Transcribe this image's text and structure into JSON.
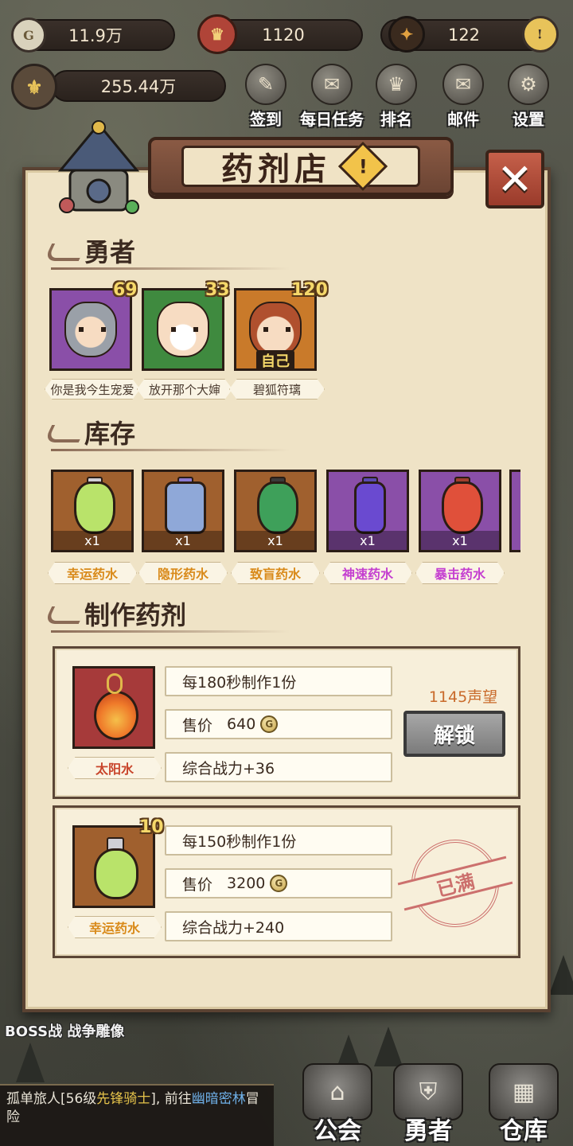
{
  "resources": {
    "gold": "11.9万",
    "honor": "1120",
    "gems": "122",
    "power": "255.44万"
  },
  "top_menu": [
    {
      "label": "签到",
      "icon": "sign-in-icon"
    },
    {
      "label": "每日任务",
      "icon": "daily-quest-icon"
    },
    {
      "label": "排名",
      "icon": "ranking-icon"
    },
    {
      "label": "邮件",
      "icon": "mail-icon"
    },
    {
      "label": "设置",
      "icon": "settings-gear-icon"
    }
  ],
  "panel": {
    "title": "药剂店",
    "sections": {
      "heroes": "勇者",
      "inventory": "库存",
      "crafting": "制作药剂"
    }
  },
  "heroes": [
    {
      "name": "你是我今生宠爱",
      "level": "69",
      "frame_color": "#8a4fa8",
      "self": false
    },
    {
      "name": "放开那个大婶",
      "level": "33",
      "frame_color": "#3f8a3f",
      "self": false
    },
    {
      "name": "碧狐符璃",
      "level": "120",
      "frame_color": "#c97a2a",
      "self": true,
      "self_label": "自己"
    }
  ],
  "inventory": [
    {
      "name": "幸运药水",
      "qty": "x1",
      "name_color": "#d98a1a",
      "frame_color": "#a0602e",
      "liquid": "#b9e36a"
    },
    {
      "name": "隐形药水",
      "qty": "x1",
      "name_color": "#d98a1a",
      "frame_color": "#a0602e",
      "liquid": "#8fa8d8"
    },
    {
      "name": "致盲药水",
      "qty": "x1",
      "name_color": "#d98a1a",
      "frame_color": "#a0602e",
      "liquid": "#3ea05a"
    },
    {
      "name": "神速药水",
      "qty": "x1",
      "name_color": "#c43ed0",
      "frame_color": "#8a4fa8",
      "liquid": "#6a4ad0"
    },
    {
      "name": "暴击药水",
      "qty": "x1",
      "name_color": "#c43ed0",
      "frame_color": "#8a4fa8",
      "liquid": "#e0503a"
    }
  ],
  "recipes": [
    {
      "name": "太阳水",
      "name_color": "#c8442a",
      "frame_color": "#a63a3a",
      "liquid": "#ef7a2a",
      "produce": "每180秒制作1份",
      "price_label": "售价",
      "price": "640",
      "power": "综合战力+36",
      "reputation": "1145声望",
      "action": "解锁",
      "locked": true
    },
    {
      "name": "幸运药水",
      "name_color": "#d98a1a",
      "frame_color": "#a0602e",
      "liquid": "#b9e36a",
      "level": "10",
      "produce": "每150秒制作1份",
      "price_label": "售价",
      "price": "3200",
      "power": "综合战力+240",
      "status": "已满",
      "locked": false
    }
  ],
  "bottom": {
    "boss_label": "BOSS战 战争雕像",
    "chat_line1": "孤单旅人[56级",
    "chat_class": "先锋骑士",
    "chat_line2": "], 前往",
    "chat_place": "幽暗密林",
    "chat_line3": "冒险",
    "nav": [
      {
        "label": "公会",
        "icon": "guild-icon"
      },
      {
        "label": "勇者",
        "icon": "hero-helmet-icon"
      },
      {
        "label": "仓库",
        "icon": "warehouse-icon"
      }
    ]
  }
}
